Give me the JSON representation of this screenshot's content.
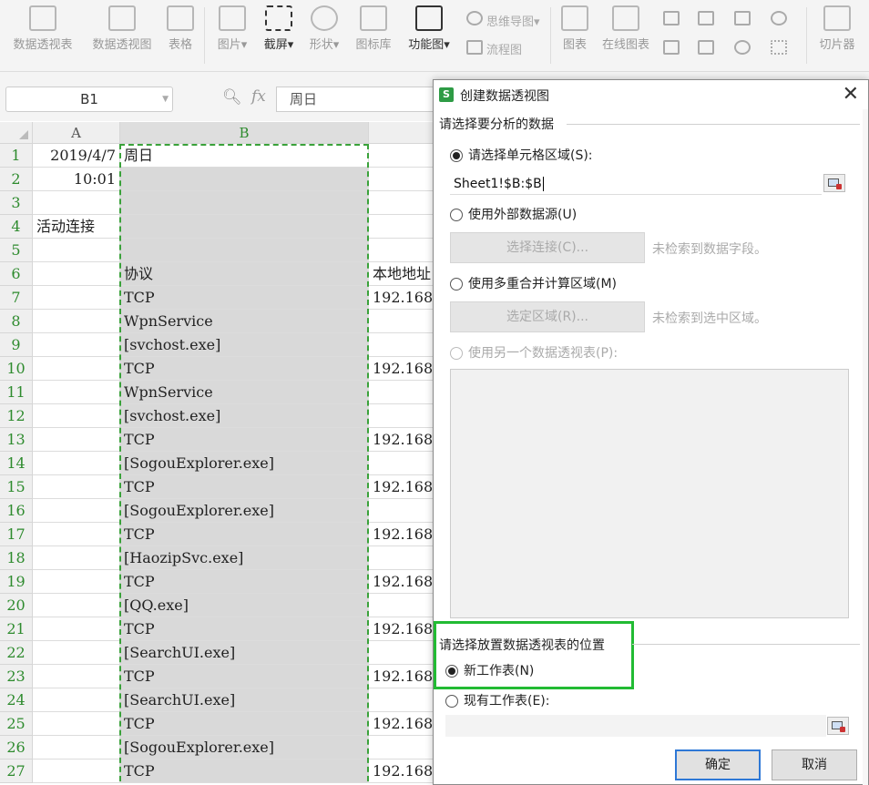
{
  "ribbon": {
    "items": [
      {
        "label": "数据透视表",
        "icon": "pivot-table-icon"
      },
      {
        "label": "数据透视图",
        "icon": "pivot-chart-icon"
      },
      {
        "label": "表格",
        "icon": "table-icon"
      },
      {
        "label": "图片▾",
        "icon": "picture-icon"
      },
      {
        "label": "截屏▾",
        "icon": "screenshot-icon"
      },
      {
        "label": "形状▾",
        "icon": "shape-icon"
      },
      {
        "label": "图标库",
        "icon": "icon-library-icon"
      },
      {
        "label": "功能图▾",
        "icon": "function-chart-icon"
      },
      {
        "label": "图表",
        "icon": "chart-icon"
      },
      {
        "label": "在线图表",
        "icon": "online-chart-icon"
      },
      {
        "label": "切片器",
        "icon": "slicer-icon"
      }
    ],
    "mindmap_label": "思维导图▾",
    "flowchart_label": "流程图"
  },
  "formula_bar": {
    "name_box": "B1",
    "fx": "fx",
    "value": "周日"
  },
  "grid": {
    "columns": [
      "A",
      "B"
    ],
    "rows": [
      {
        "n": "1",
        "a": "2019/4/7",
        "b": "周日",
        "c": ""
      },
      {
        "n": "2",
        "a": "10:01",
        "b": "",
        "c": ""
      },
      {
        "n": "3",
        "a": "",
        "b": "",
        "c": ""
      },
      {
        "n": "4",
        "a": "活动连接",
        "b": "",
        "c": ""
      },
      {
        "n": "5",
        "a": "",
        "b": "",
        "c": ""
      },
      {
        "n": "6",
        "a": "",
        "b": "协议",
        "c": "本地地址"
      },
      {
        "n": "7",
        "a": "",
        "b": "TCP",
        "c": "192.168"
      },
      {
        "n": "8",
        "a": "",
        "b": "WpnService",
        "c": ""
      },
      {
        "n": "9",
        "a": "",
        "b": "[svchost.exe]",
        "c": ""
      },
      {
        "n": "10",
        "a": "",
        "b": "TCP",
        "c": "192.168"
      },
      {
        "n": "11",
        "a": "",
        "b": "WpnService",
        "c": ""
      },
      {
        "n": "12",
        "a": "",
        "b": "[svchost.exe]",
        "c": ""
      },
      {
        "n": "13",
        "a": "",
        "b": "TCP",
        "c": "192.168"
      },
      {
        "n": "14",
        "a": "",
        "b": "[SogouExplorer.exe]",
        "c": ""
      },
      {
        "n": "15",
        "a": "",
        "b": "TCP",
        "c": "192.168"
      },
      {
        "n": "16",
        "a": "",
        "b": "[SogouExplorer.exe]",
        "c": ""
      },
      {
        "n": "17",
        "a": "",
        "b": "TCP",
        "c": "192.168"
      },
      {
        "n": "18",
        "a": "",
        "b": "[HaozipSvc.exe]",
        "c": ""
      },
      {
        "n": "19",
        "a": "",
        "b": "TCP",
        "c": "192.168"
      },
      {
        "n": "20",
        "a": "",
        "b": "[QQ.exe]",
        "c": ""
      },
      {
        "n": "21",
        "a": "",
        "b": "TCP",
        "c": "192.168"
      },
      {
        "n": "22",
        "a": "",
        "b": "[SearchUI.exe]",
        "c": ""
      },
      {
        "n": "23",
        "a": "",
        "b": "TCP",
        "c": "192.168"
      },
      {
        "n": "24",
        "a": "",
        "b": "[SearchUI.exe]",
        "c": ""
      },
      {
        "n": "25",
        "a": "",
        "b": "TCP",
        "c": "192.168"
      },
      {
        "n": "26",
        "a": "",
        "b": "[SogouExplorer.exe]",
        "c": ""
      },
      {
        "n": "27",
        "a": "",
        "b": "TCP",
        "c": "192.168"
      }
    ]
  },
  "dialog": {
    "title": "创建数据透视图",
    "section1": "请选择要分析的数据",
    "opt_range": "请选择单元格区域(S):",
    "range_value": "Sheet1!$B:$B",
    "opt_external": "使用外部数据源(U)",
    "btn_choose_conn": "选择连接(C)...",
    "hint_conn": "未检索到数据字段。",
    "opt_multi": "使用多重合并计算区域(M)",
    "btn_select_range": "选定区域(R)...",
    "hint_range": "未检索到选中区域。",
    "opt_other_pivot": "使用另一个数据透视表(P):",
    "section2": "请选择放置数据透视表的位置",
    "opt_new_sheet": "新工作表(N)",
    "opt_existing_sheet": "现有工作表(E):",
    "ok": "确定",
    "cancel": "取消"
  },
  "colors": {
    "selection_green": "#3aa23a",
    "highlight_green": "#22bb33",
    "primary_border": "#2e78d6"
  }
}
